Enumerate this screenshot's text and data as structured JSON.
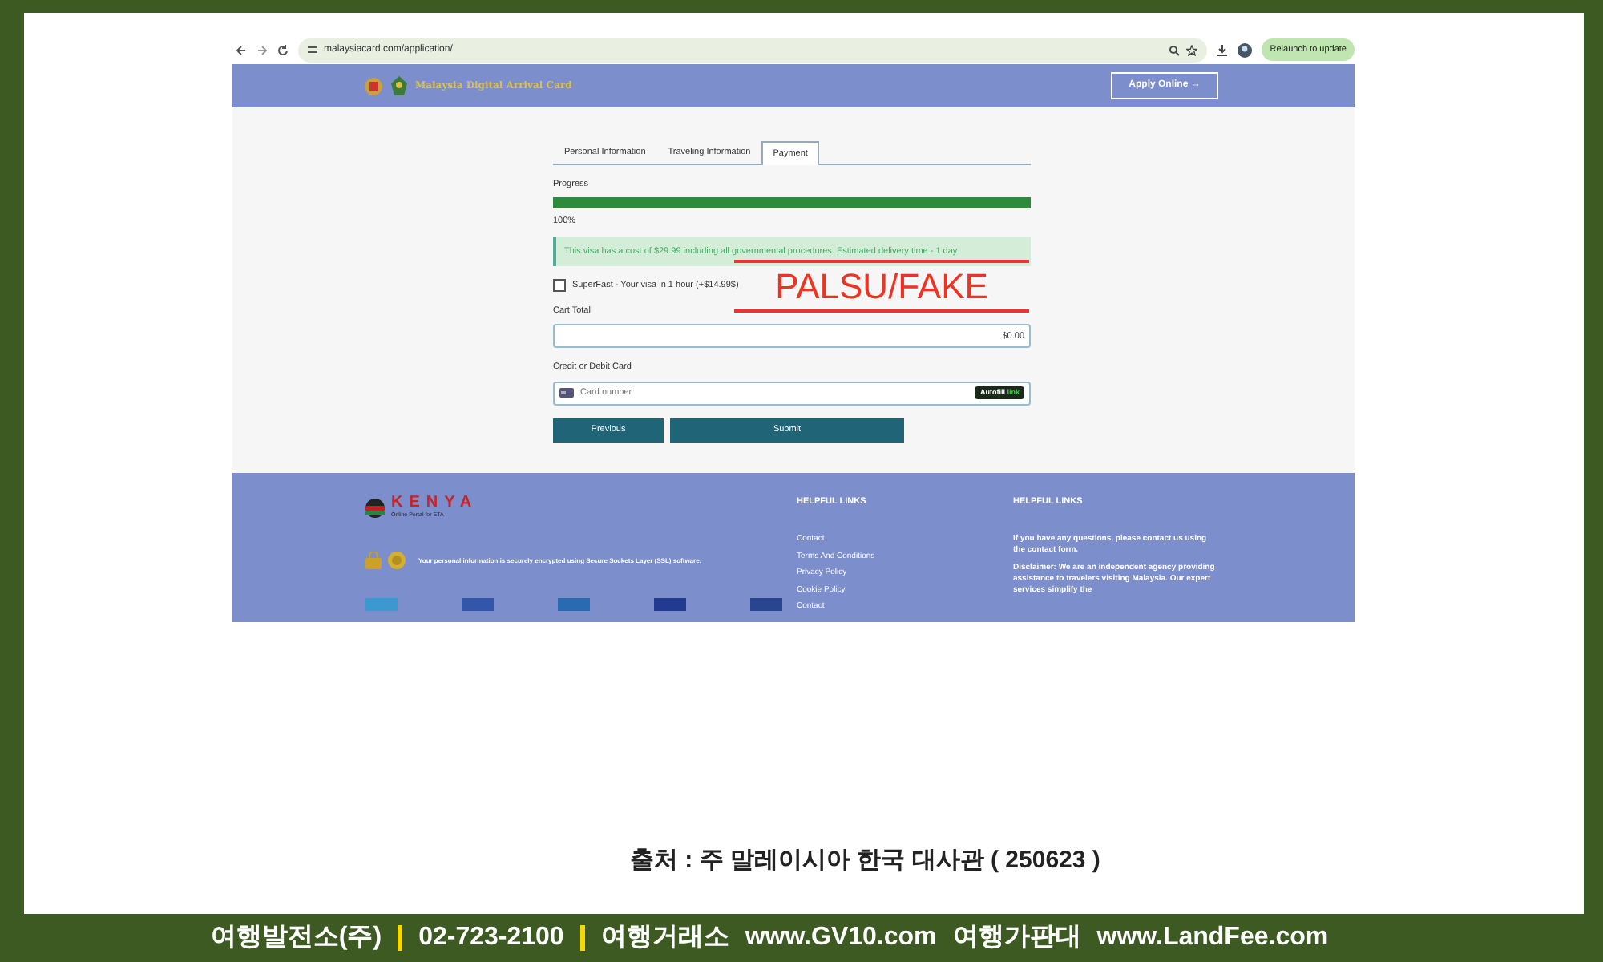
{
  "browser": {
    "url": "malaysiacard.com/application/",
    "relaunch": "Relaunch to update"
  },
  "site_header": {
    "title": "Malaysia Digital Arrival Card",
    "apply_button": "Apply Online →"
  },
  "tabs": [
    {
      "label": "Personal Information",
      "selected": false
    },
    {
      "label": "Traveling Information",
      "selected": false
    },
    {
      "label": "Payment",
      "selected": true
    }
  ],
  "progress": {
    "label": "Progress",
    "level": 1,
    "reading": "100%"
  },
  "notice": "This visa has a cost of $29.99 including all governmental procedures. Estimated delivery time - 1 day",
  "superfast": {
    "label": "SuperFast - Your visa in 1 hour (+$14.99$)",
    "checked": false
  },
  "stamp": "PALSU/FAKE",
  "cart_total": {
    "label": "Cart Total",
    "value": "$0.00"
  },
  "card": {
    "label": "Credit or Debit Card",
    "placeholder": "Card number",
    "autofill": "Autofill",
    "link": "link"
  },
  "buttons": [
    "Previous",
    "Submit"
  ],
  "footer": {
    "brand": "KENYA",
    "tagline": "Online Portal for ETA",
    "ssl_text": "Your personal information is securely encrypted using Secure Sockets Layer (SSL) software.",
    "links_heading": "HELPFUL LINKS",
    "links": [
      "Contact",
      "Terms And Conditions",
      "Privacy Policy",
      "Cookie Policy",
      "Contact"
    ],
    "info_heading": "HELPFUL LINKS",
    "info": [
      "If you have any questions, please contact us using the contact form.",
      "**Disclaimer:** We are an independent agency providing assistance to travelers visiting Malaysia. Our expert services simplify the"
    ]
  },
  "caption": "출처 : 주 말레이시아 한국 대사관 ( 250623 )",
  "banner": [
    "여행발전소(주)",
    "02-723-2100",
    "여행거래소",
    "www.GV10.com",
    "여행가판대",
    "www.LandFee.com"
  ]
}
